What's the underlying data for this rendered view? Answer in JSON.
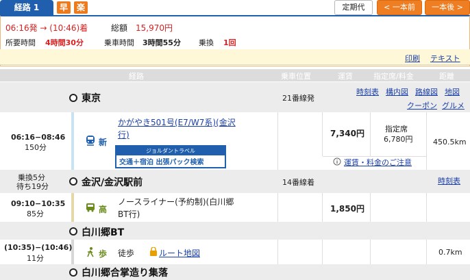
{
  "header": {
    "route_tab": "経路 1",
    "badge_fast": "早",
    "badge_easy": "楽",
    "teiki_btn": "定期代",
    "prev_btn": "< 一本前",
    "next_btn": "一本後 >"
  },
  "summary": {
    "time_range": "06:16発 → (10:46)着",
    "total_label": "総額",
    "total_value": "15,970円",
    "duration_label": "所要時間",
    "duration_value": "4時間30分",
    "ride_label": "乗車時間",
    "ride_value": "3時間55分",
    "transfer_label": "乗換",
    "transfer_value": "1回"
  },
  "tools": {
    "print": "印刷",
    "text": "テキスト"
  },
  "table_header": {
    "route": "経路",
    "position": "乗車位置",
    "fare": "運賃",
    "reserved": "指定席/料金",
    "distance": "距離"
  },
  "stations": [
    {
      "name": "東京",
      "platform": "21番線発",
      "links": [
        "時刻表",
        "構内図",
        "路線図",
        "地図",
        "クーポン",
        "グルメ"
      ]
    },
    {
      "name": "金沢/金沢駅前",
      "platform": "14番線着",
      "links": [
        "時刻表"
      ],
      "transfer": "乗換5分",
      "wait": "待ち19分"
    },
    {
      "name": "白川郷BT"
    },
    {
      "name": "白川郷合掌造り集落"
    }
  ],
  "segments": [
    {
      "time": "06:16−08:46",
      "duration": "150分",
      "mode": "新",
      "line": "かがやき501号(E7/W7系)(金沢行)",
      "fare": "7,340円",
      "reserved_label": "指定席",
      "reserved_value": "6,780円",
      "distance": "450.5km",
      "fare_note": "運賃・料金のご注意"
    },
    {
      "time": "09:10−10:35",
      "duration": "85分",
      "mode": "高",
      "line": "ノースライナー(予約制)(白川郷BT行)",
      "fare": "1,850円"
    },
    {
      "time": "(10:35)−(10:46)",
      "duration": "11分",
      "mode": "歩",
      "line": "徒歩",
      "map_link": "ルート地図",
      "distance": "0.7km"
    }
  ],
  "pack_banner": {
    "top": "ジョルダントラベル",
    "bottom": "交通＋宿泊 出張パック検索"
  },
  "colors": {
    "accent_blue": "#1f5fae",
    "accent_orange": "#ef7d22",
    "price_red": "#d82020"
  }
}
